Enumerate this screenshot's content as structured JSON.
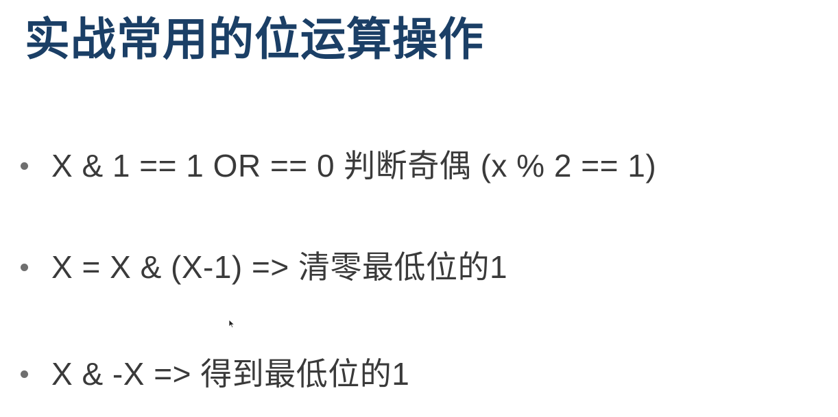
{
  "slide": {
    "title": "实战常用的位运算操作",
    "bullets": [
      {
        "text": "X & 1 == 1 OR == 0 判断奇偶 (x % 2 == 1)"
      },
      {
        "text": "X = X & (X-1) => 清零最低位的1"
      },
      {
        "text": "X & -X => 得到最低位的1"
      }
    ]
  },
  "colors": {
    "title": "#1b3f66",
    "body_text": "#3a3a3a",
    "bullet_dot": "#6f6f6f",
    "background": "#ffffff"
  },
  "icons": {
    "cursor": "mouse-pointer-icon"
  }
}
